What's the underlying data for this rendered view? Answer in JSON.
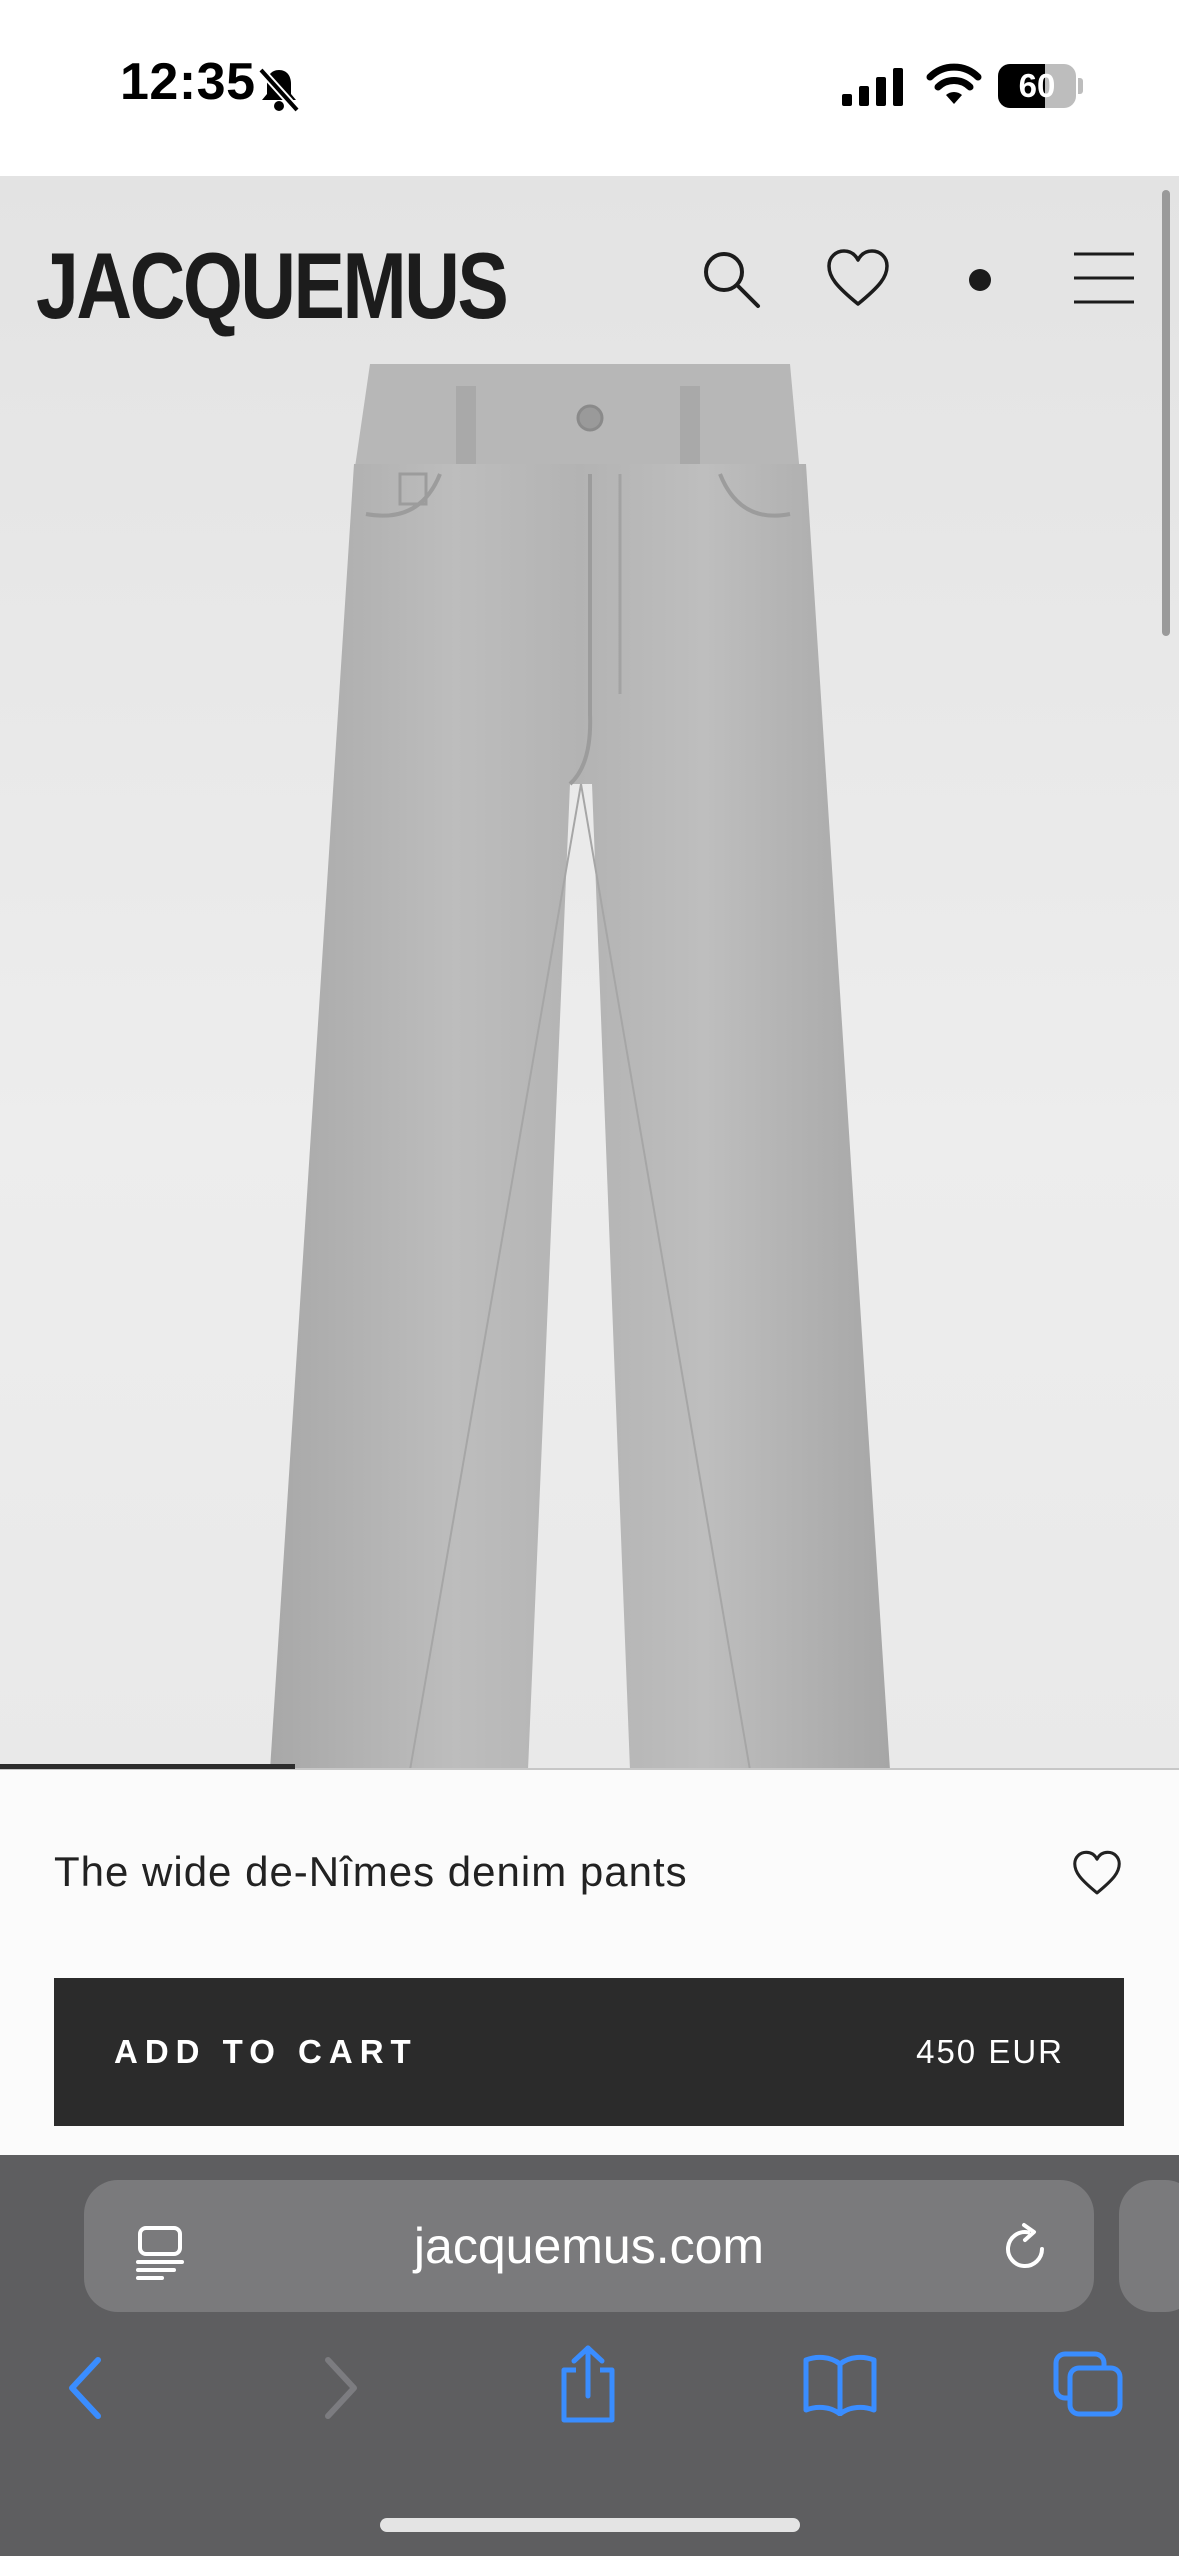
{
  "status_bar": {
    "time": "12:35",
    "battery_level": "60",
    "battery_fraction": 0.6
  },
  "site": {
    "logo": "JACQUEMUS",
    "header_icons": [
      "search-icon",
      "heart-icon",
      "cart-dot-icon",
      "menu-icon"
    ]
  },
  "product": {
    "name": "The wide de-Nîmes denim pants",
    "add_to_cart_label": "ADD TO CART",
    "price": "450 EUR",
    "gallery_progress": 0.25
  },
  "browser": {
    "url": "jacquemus.com",
    "toolbar_icons": [
      "back-icon",
      "forward-icon",
      "share-icon",
      "bookmarks-icon",
      "tabs-icon"
    ]
  },
  "colors": {
    "brand_text": "#1c1c1c",
    "cart_button": "#2b2b2b",
    "browser_accent": "#3a8dff",
    "browser_chrome": "#5e5e60"
  }
}
